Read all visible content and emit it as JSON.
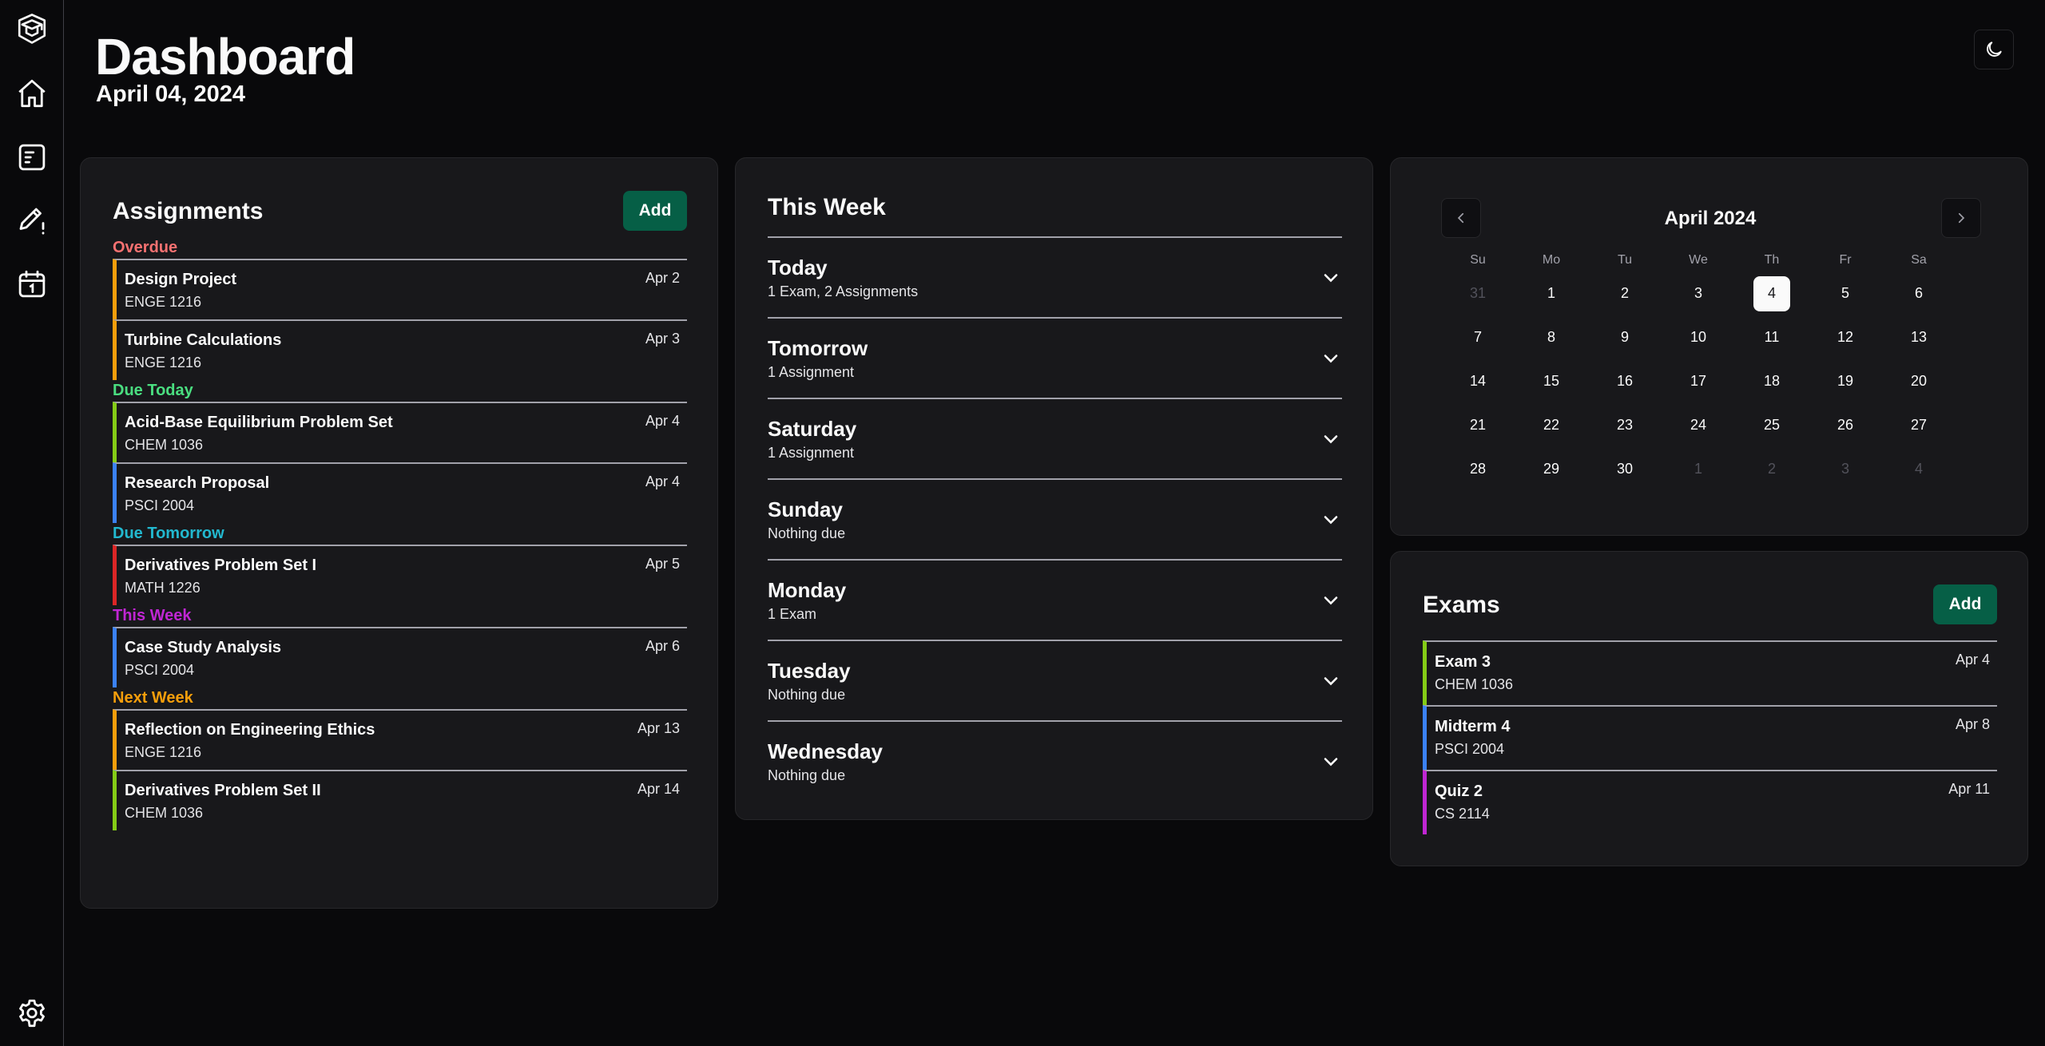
{
  "header": {
    "title": "Dashboard",
    "date": "April 04, 2024"
  },
  "sidebar": {
    "items": [
      {
        "name": "logo",
        "icon": "graduation-cap-box-icon"
      },
      {
        "name": "home",
        "icon": "home-icon"
      },
      {
        "name": "assignments",
        "icon": "list-document-icon"
      },
      {
        "name": "exams",
        "icon": "pencil-alert-icon"
      },
      {
        "name": "calendar",
        "icon": "calendar-icon"
      },
      {
        "name": "settings",
        "icon": "gear-icon"
      }
    ]
  },
  "assignments": {
    "title": "Assignments",
    "add_label": "Add",
    "groups": [
      {
        "label": "Overdue",
        "color": "#f87171",
        "items": [
          {
            "name": "Design Project",
            "course": "ENGE 1216",
            "date": "Apr 2",
            "color": "#f59e0b"
          },
          {
            "name": "Turbine Calculations",
            "course": "ENGE 1216",
            "date": "Apr 3",
            "color": "#f59e0b"
          }
        ]
      },
      {
        "label": "Due Today",
        "color": "#4ade80",
        "items": [
          {
            "name": "Acid-Base Equilibrium Problem Set",
            "course": "CHEM 1036",
            "date": "Apr 4",
            "color": "#84cc16"
          },
          {
            "name": "Research Proposal",
            "course": "PSCI 2004",
            "date": "Apr 4",
            "color": "#3b82f6"
          }
        ]
      },
      {
        "label": "Due Tomorrow",
        "color": "#22b8cf",
        "items": [
          {
            "name": "Derivatives Problem Set I",
            "course": "MATH 1226",
            "date": "Apr 5",
            "color": "#dc2626"
          }
        ]
      },
      {
        "label": "This Week",
        "color": "#c026d3",
        "items": [
          {
            "name": "Case Study Analysis",
            "course": "PSCI 2004",
            "date": "Apr 6",
            "color": "#3b82f6"
          }
        ]
      },
      {
        "label": "Next Week",
        "color": "#f59e0b",
        "items": [
          {
            "name": "Reflection on Engineering Ethics",
            "course": "ENGE 1216",
            "date": "Apr 13",
            "color": "#f59e0b"
          },
          {
            "name": "Derivatives Problem Set II",
            "course": "CHEM 1036",
            "date": "Apr 14",
            "color": "#84cc16"
          }
        ]
      }
    ]
  },
  "week": {
    "title": "This Week",
    "days": [
      {
        "day": "Today",
        "summary": "1 Exam, 2 Assignments"
      },
      {
        "day": "Tomorrow",
        "summary": "1 Assignment"
      },
      {
        "day": "Saturday",
        "summary": "1 Assignment"
      },
      {
        "day": "Sunday",
        "summary": "Nothing due"
      },
      {
        "day": "Monday",
        "summary": "1 Exam"
      },
      {
        "day": "Tuesday",
        "summary": "Nothing due"
      },
      {
        "day": "Wednesday",
        "summary": "Nothing due"
      }
    ]
  },
  "calendar": {
    "title": "April 2024",
    "prev_icon": "chevron-left-icon",
    "next_icon": "chevron-right-icon",
    "weekdays": [
      "Su",
      "Mo",
      "Tu",
      "We",
      "Th",
      "Fr",
      "Sa"
    ],
    "selected": "4",
    "days": [
      {
        "d": "31",
        "muted": true
      },
      {
        "d": "1"
      },
      {
        "d": "2"
      },
      {
        "d": "3"
      },
      {
        "d": "4",
        "today": true
      },
      {
        "d": "5"
      },
      {
        "d": "6"
      },
      {
        "d": "7"
      },
      {
        "d": "8"
      },
      {
        "d": "9"
      },
      {
        "d": "10"
      },
      {
        "d": "11"
      },
      {
        "d": "12"
      },
      {
        "d": "13"
      },
      {
        "d": "14"
      },
      {
        "d": "15"
      },
      {
        "d": "16"
      },
      {
        "d": "17"
      },
      {
        "d": "18"
      },
      {
        "d": "19"
      },
      {
        "d": "20"
      },
      {
        "d": "21"
      },
      {
        "d": "22"
      },
      {
        "d": "23"
      },
      {
        "d": "24"
      },
      {
        "d": "25"
      },
      {
        "d": "26"
      },
      {
        "d": "27"
      },
      {
        "d": "28"
      },
      {
        "d": "29"
      },
      {
        "d": "30"
      },
      {
        "d": "1",
        "muted": true
      },
      {
        "d": "2",
        "muted": true
      },
      {
        "d": "3",
        "muted": true
      },
      {
        "d": "4",
        "muted": true
      }
    ]
  },
  "exams": {
    "title": "Exams",
    "add_label": "Add",
    "items": [
      {
        "name": "Exam 3",
        "course": "CHEM 1036",
        "date": "Apr 4",
        "color": "#84cc16"
      },
      {
        "name": "Midterm 4",
        "course": "PSCI 2004",
        "date": "Apr 8",
        "color": "#3b82f6"
      },
      {
        "name": "Quiz 2",
        "course": "CS 2114",
        "date": "Apr 11",
        "color": "#c026d3"
      }
    ]
  },
  "theme_toggle": {
    "icon": "moon-icon"
  }
}
